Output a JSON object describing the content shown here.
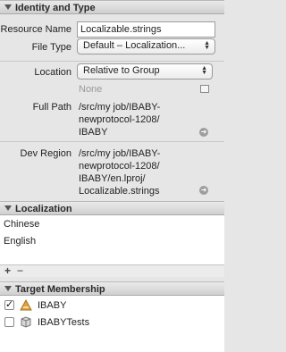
{
  "identity": {
    "header": "Identity and Type",
    "resource_name_label": "Resource Name",
    "resource_name_value": "Localizable.strings",
    "file_type_label": "File Type",
    "file_type_value": "Default – Localization...",
    "location_label": "Location",
    "location_value": "Relative to Group",
    "location_placeholder": "None",
    "full_path_label": "Full Path",
    "full_path_lines": [
      "/src/my job/IBABY-",
      "newprotocol-1208/",
      "IBABY"
    ],
    "dev_region_label": "Dev Region",
    "dev_region_lines": [
      "/src/my job/IBABY-",
      "newprotocol-1208/",
      "IBABY/en.lproj/",
      "Localizable.strings"
    ]
  },
  "localization": {
    "header": "Localization",
    "items": [
      "Chinese",
      "English"
    ],
    "add_label": "+",
    "remove_label": "−"
  },
  "target_membership": {
    "header": "Target Membership",
    "targets": [
      {
        "name": "IBABY",
        "checked": "✓",
        "icon": "app-target-icon"
      },
      {
        "name": "IBABYTests",
        "checked": "",
        "icon": "test-bundle-icon"
      }
    ]
  },
  "colors": {
    "selected_row": "#3875d7",
    "panel_bg": "#e6e6e6",
    "list_bg": "#ffffff"
  }
}
